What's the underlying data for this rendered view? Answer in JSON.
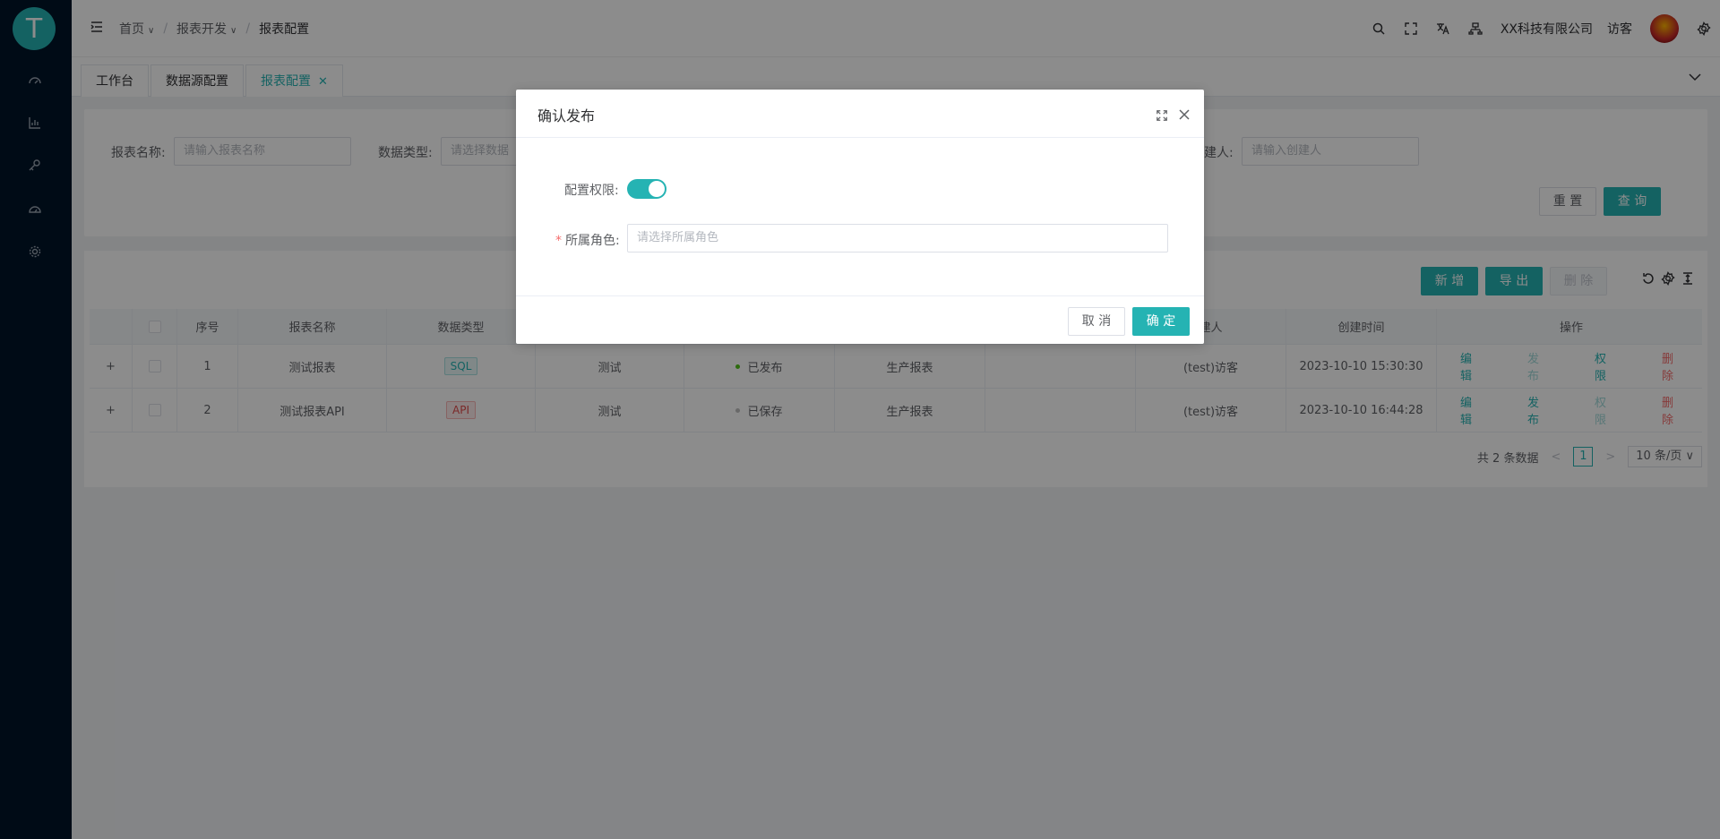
{
  "sidebar": {
    "logo_text": "T",
    "items": [
      {
        "icon": "dashboard-icon"
      },
      {
        "icon": "chart-icon"
      },
      {
        "icon": "key-icon"
      },
      {
        "icon": "gauge-icon"
      },
      {
        "icon": "settings-icon"
      }
    ]
  },
  "header": {
    "breadcrumb": [
      "首页",
      "报表开发",
      "报表配置"
    ],
    "company": "XX科技有限公司",
    "user": "访客",
    "icons": [
      "search-icon",
      "fullscreen-icon",
      "translate-icon",
      "layout-icon",
      "gear-icon"
    ]
  },
  "tabs": [
    {
      "label": "工作台"
    },
    {
      "label": "数据源配置"
    },
    {
      "label": "报表配置",
      "close": "✕"
    }
  ],
  "search": {
    "name_label": "报表名称:",
    "name_placeholder": "请输入报表名称",
    "type_label": "数据类型:",
    "type_placeholder": "请选择数据",
    "creator_label": "建人:",
    "creator_placeholder": "请输入创建人",
    "reset_label": "重 置",
    "query_label": "查 询"
  },
  "toolbar": {
    "add_label": "新 增",
    "export_label": "导 出",
    "delete_label": "删 除"
  },
  "table": {
    "headers": {
      "index": "序号",
      "name": "报表名称",
      "datatype": "数据类型",
      "creator": "建人",
      "created": "创建时间",
      "actions": "操作"
    },
    "rows": [
      {
        "expand": "+",
        "index": "1",
        "name": "测试报表",
        "tag": "SQL",
        "group": "测试",
        "status": "已发布",
        "category": "生产报表",
        "creator": "(test)访客",
        "created": "2023-10-10 15:30:30",
        "a1": "编辑",
        "a2": "发布",
        "a3": "权限",
        "a4": "删除"
      },
      {
        "expand": "+",
        "index": "2",
        "name": "测试报表API",
        "tag": "API",
        "group": "测试",
        "status": "已保存",
        "category": "生产报表",
        "creator": "(test)访客",
        "created": "2023-10-10 16:44:28",
        "a1": "编辑",
        "a2": "发布",
        "a3": "权限",
        "a4": "删除"
      }
    ]
  },
  "pager": {
    "total": "共 2 条数据",
    "current": "1",
    "size": "10 条/页"
  },
  "dialog": {
    "title": "确认发布",
    "perm_label": "配置权限:",
    "role_label": "所属角色:",
    "role_required": "*",
    "role_placeholder": "请选择所属角色",
    "cancel_label": "取 消",
    "ok_label": "确 定"
  },
  "colors": {
    "primary": "#25b3b3",
    "sidebar": "#001529",
    "danger": "#f56c6c"
  }
}
